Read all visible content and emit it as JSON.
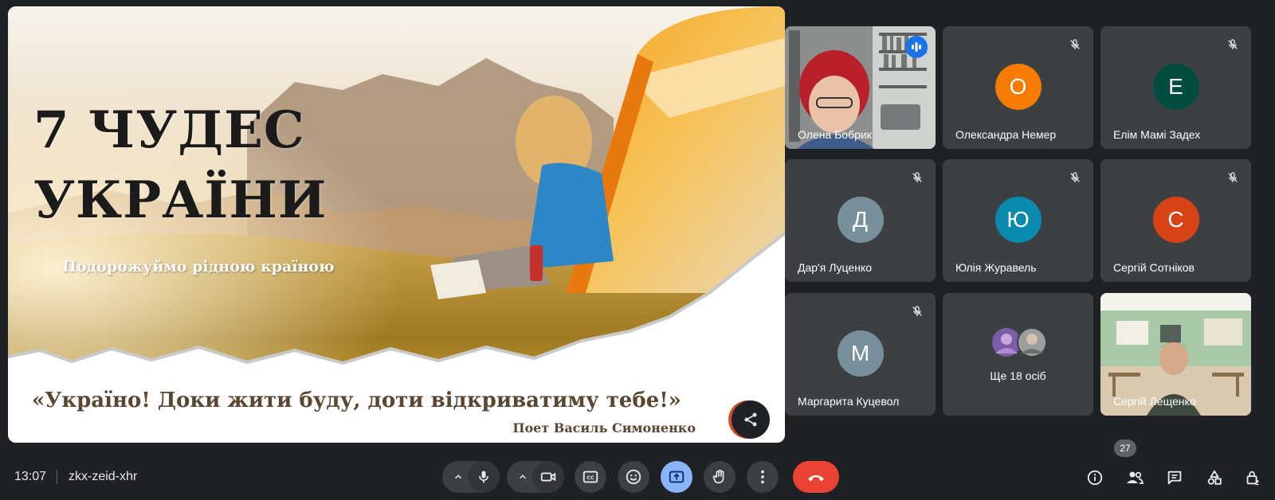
{
  "slide": {
    "title_line1": "7 ЧУДЕС",
    "title_line2": "УКРАЇНИ",
    "subtitle": "Подорожуймо рідною країною",
    "quote": "«Україно! Доки жити буду, доти відкриватиму тебе!»",
    "author": "Поет Василь Симоненко"
  },
  "participants": [
    {
      "name": "Олена Бобрик",
      "type": "video",
      "speaking": true
    },
    {
      "name": "Олександра Немер",
      "initial": "О",
      "color": "#f57c00",
      "muted": true
    },
    {
      "name": "Елім Мамі Задех",
      "initial": "Е",
      "color": "#004d40",
      "muted": true
    },
    {
      "name": "Дар'я Луценко",
      "initial": "Д",
      "color": "#78909c",
      "muted": true
    },
    {
      "name": "Юлія Журавель",
      "initial": "Ю",
      "color": "#0b8aaf",
      "muted": true
    },
    {
      "name": "Сергій Сотніков",
      "initial": "С",
      "color": "#d84315",
      "muted": true
    },
    {
      "name": "Маргарита Куцевол",
      "initial": "М",
      "color": "#78909c",
      "muted": true
    },
    {
      "name": "Сергій Лещенко",
      "type": "video"
    }
  ],
  "others": {
    "label": "Ще 18 осіб"
  },
  "bottom_bar": {
    "time": "13:07",
    "meeting_code": "zkx-zeid-xhr",
    "people_count": "27"
  },
  "colors": {
    "background": "#202124",
    "tile": "#3c4043",
    "end_call": "#ea4335",
    "present_active": "#8ab4f8",
    "active_outline": "#8ab4f8"
  }
}
